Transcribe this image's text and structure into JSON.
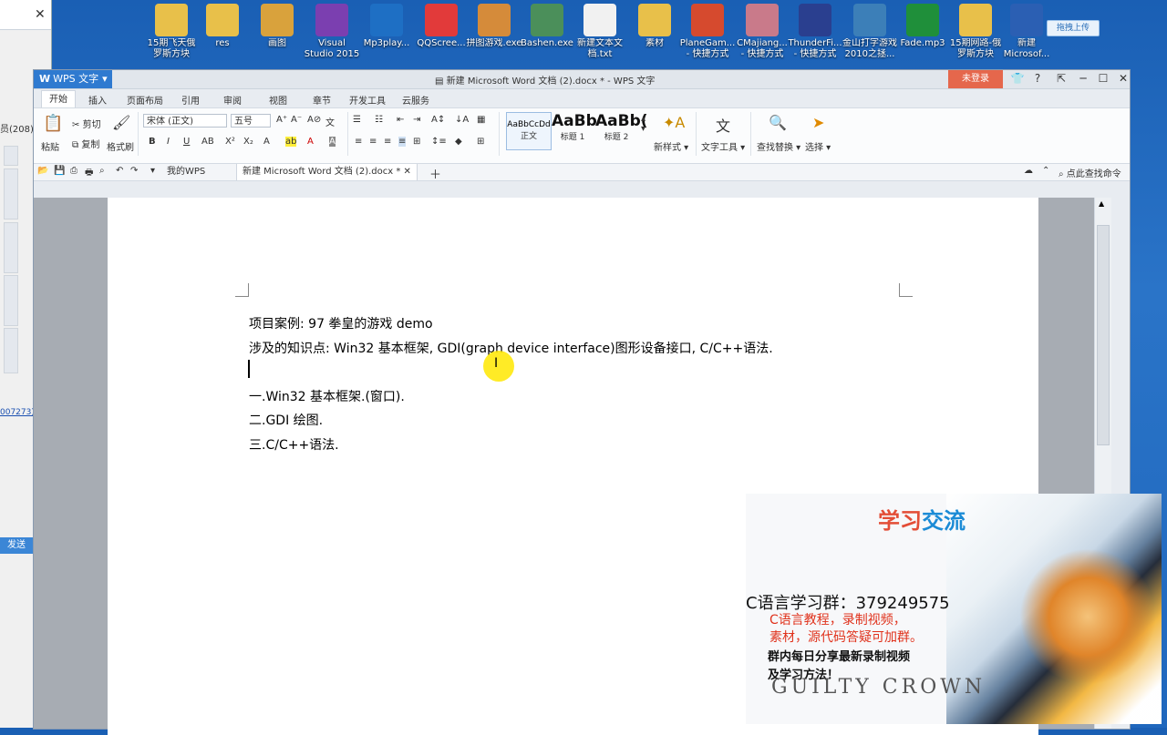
{
  "desktop_icons": [
    {
      "label": "15期飞天俄\n罗斯方块",
      "icon": "folder-icon",
      "color": "#e8c04a"
    },
    {
      "label": "res",
      "icon": "folder-icon",
      "color": "#e8c04a"
    },
    {
      "label": "画图",
      "icon": "paint-icon",
      "color": "#d9a23c"
    },
    {
      "label": "Visual\nStudio 2015",
      "icon": "visual-studio-icon",
      "color": "#7b3fb0"
    },
    {
      "label": "Mp3play...",
      "icon": "headphones-icon",
      "color": "#1e6fc4"
    },
    {
      "label": "QQScree...",
      "icon": "scissors-icon",
      "color": "#e23a3a"
    },
    {
      "label": "拼图游戏.exe",
      "icon": "game-icon",
      "color": "#d58b3a"
    },
    {
      "label": "Bashen.exe",
      "icon": "app-icon",
      "color": "#4b8f5a"
    },
    {
      "label": "新建文本文\n档.txt",
      "icon": "text-file-icon",
      "color": "#f1f1f1"
    },
    {
      "label": "素材",
      "icon": "folder-icon",
      "color": "#e8c04a"
    },
    {
      "label": "PlaneGam...\n- 快捷方式",
      "icon": "shortcut-icon",
      "color": "#d64a2e"
    },
    {
      "label": "CMajiang...\n- 快捷方式",
      "icon": "shortcut-icon",
      "color": "#c97a8a"
    },
    {
      "label": "ThunderFi...\n- 快捷方式",
      "icon": "shortcut-icon",
      "color": "#2a3f8f"
    },
    {
      "label": "金山打字游戏\n2010之拯...",
      "icon": "game-icon",
      "color": "#3c7fb8"
    },
    {
      "label": "Fade.mp3",
      "icon": "audio-file-icon",
      "color": "#1f8f3a"
    },
    {
      "label": "15期网路-俄\n罗斯方块",
      "icon": "folder-icon",
      "color": "#e8c04a"
    },
    {
      "label": "新建\nMicrosof...",
      "icon": "word-file-icon",
      "color": "#2b5fb3"
    }
  ],
  "desktop_upload_label": "拖拽上传",
  "left_window": {
    "close_label": "✕",
    "member_count": "员(208)",
    "link_text": "007273)",
    "send_label": "发送"
  },
  "wps": {
    "app_label": "WPS 文字",
    "window_title": "新建 Microsoft Word 文档 (2).docx * - WPS 文字",
    "login_label": "未登录",
    "menu_tabs": [
      "开始",
      "插入",
      "页面布局",
      "引用",
      "审阅",
      "视图",
      "章节",
      "开发工具",
      "云服务"
    ],
    "active_tab": "开始",
    "ribbon": {
      "paste": "粘贴",
      "cut": "剪切",
      "copy": "复制",
      "format_painter": "格式刷",
      "font_name": "宋体 (正文)",
      "font_size": "五号",
      "styles": [
        {
          "preview": "AaBbCcDd",
          "name": "正文"
        },
        {
          "preview": "AaBb",
          "name": "标题 1"
        },
        {
          "preview": "AaBb(",
          "name": "标题 2"
        }
      ],
      "new_style": "新样式",
      "text_tools": "文字工具",
      "find_replace": "查找替换",
      "select": "选择"
    },
    "doc_tabs": [
      {
        "label": "我的WPS",
        "active": false
      },
      {
        "label": "新建 Microsoft Word 文档 (2).docx *",
        "active": true
      }
    ],
    "find_command": "点此查找命令"
  },
  "document": {
    "lines": [
      "项目案例: 97 拳皇的游戏 demo",
      "涉及的知识点: Win32 基本框架,   GDI(graph device interface)图形设备接口,   C/C++语法.",
      "",
      "一.Win32 基本框架.(窗口).",
      "二.GDI 绘图.",
      "三.C/C++语法."
    ]
  },
  "ad_overlay": {
    "title_a": "学习",
    "title_b": "交流",
    "qq_group": "C语言学习群：379249575",
    "red_line1": "C语言教程，录制视频，",
    "red_line2": "素材，源代码答疑可加群。",
    "black_line1": "群内每日分享最新录制视频",
    "black_line2": "及学习方法！",
    "crown_text": "GUILTY CROWN"
  }
}
